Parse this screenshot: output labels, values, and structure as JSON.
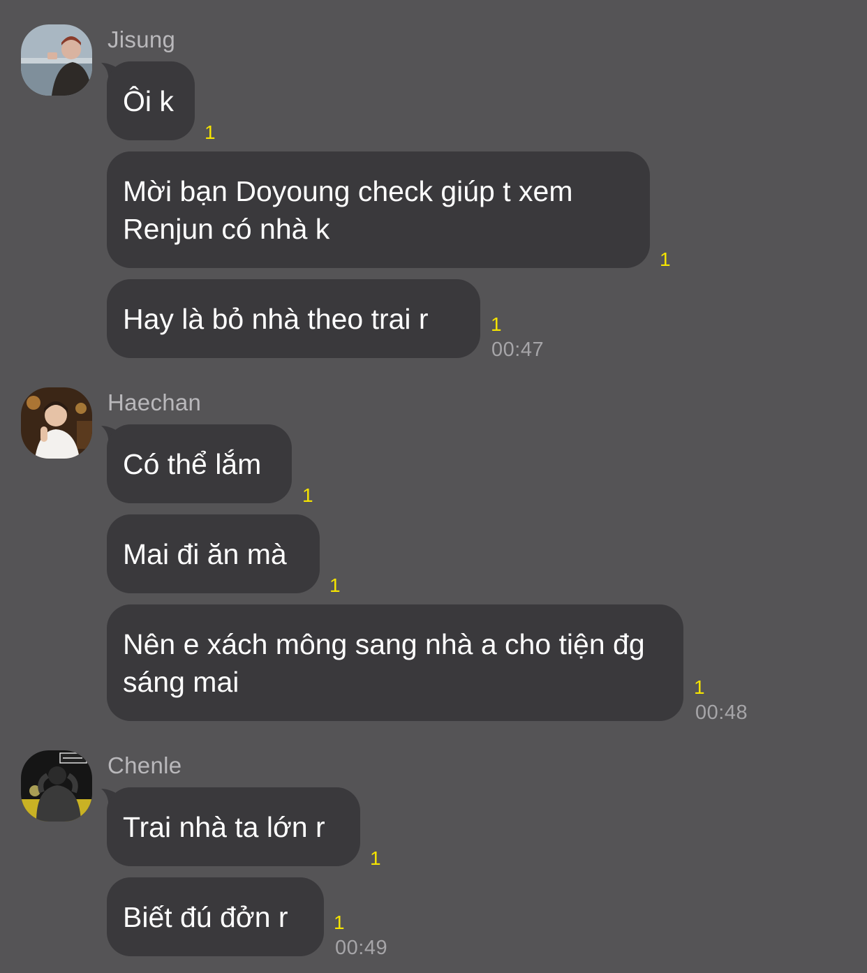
{
  "groups": [
    {
      "sender": "Jisung",
      "avatar": "avatar-photo-jisung",
      "messages": [
        {
          "text": "Ôi k",
          "unread": "1"
        },
        {
          "text": "Mời bạn Doyoung check giúp t xem Renjun có nhà k",
          "unread": "1"
        },
        {
          "text": "Hay là bỏ nhà theo trai r",
          "unread": "1",
          "time": "00:47"
        }
      ]
    },
    {
      "sender": "Haechan",
      "avatar": "avatar-photo-haechan",
      "messages": [
        {
          "text": "Có thể lắm",
          "unread": "1"
        },
        {
          "text": "Mai đi ăn mà",
          "unread": "1"
        },
        {
          "text": "Nên e xách mông sang nhà a cho tiện đg sáng mai",
          "unread": "1",
          "time": "00:48"
        }
      ]
    },
    {
      "sender": "Chenle",
      "avatar": "avatar-photo-chenle",
      "messages": [
        {
          "text": "Trai nhà ta lớn r",
          "unread": "1"
        },
        {
          "text": "Biết đú đởn r",
          "unread": "1",
          "time": "00:49"
        }
      ]
    }
  ],
  "colors": {
    "background": "#555456",
    "bubble": "#3a393c",
    "message_text": "#ffffff",
    "sender_name": "#b9b8bb",
    "unread_count": "#f5e400",
    "timestamp": "#a6a5a8"
  }
}
